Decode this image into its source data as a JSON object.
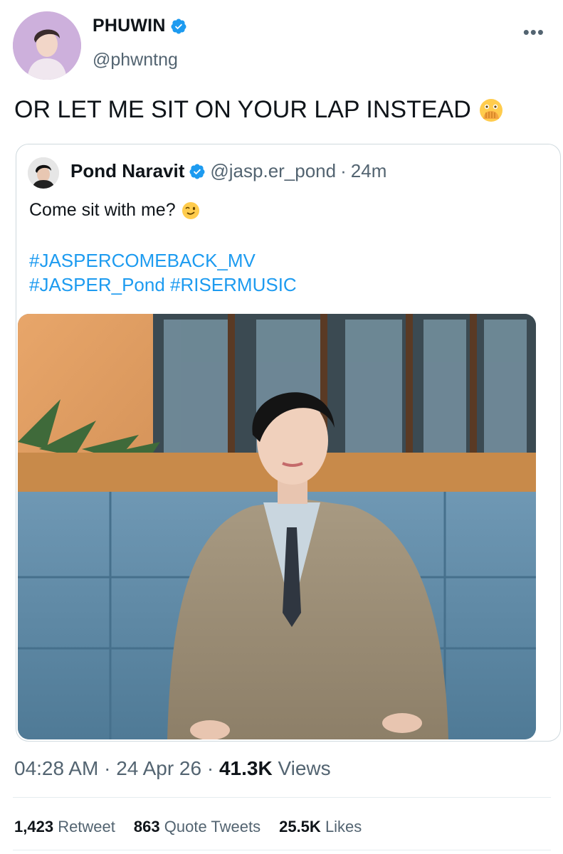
{
  "author": {
    "display_name": "PHUWIN",
    "handle": "@phwntng",
    "verified": true
  },
  "tweet": {
    "text": "OR LET ME SIT ON YOUR LAP INSTEAD",
    "emoji_icon": "face-with-open-eyes-and-hand-over-mouth-icon"
  },
  "quoted": {
    "display_name": "Pond Naravit",
    "handle": "@jasp.er_pond",
    "separator": "·",
    "age": "24m",
    "text": "Come sit with me?",
    "emoji_icon": "winking-face-icon",
    "hashtags_line1": "#JASPERCOMEBACK_MV",
    "hashtags_line2": "#JASPER_Pond #RISERMUSIC"
  },
  "footer": {
    "time": "04:28 AM",
    "date": "24 Apr 26",
    "views_count": "41.3K",
    "views_label": "Views",
    "retweets_count": "1,423",
    "retweets_label": "Retweet",
    "quotes_count": "863",
    "quotes_label": "Quote Tweets",
    "likes_count": "25.5K",
    "likes_label": "Likes"
  },
  "colors": {
    "link_blue": "#1d9bf0",
    "text": "#0f1419",
    "muted": "#536471",
    "border": "#cfd9de"
  }
}
